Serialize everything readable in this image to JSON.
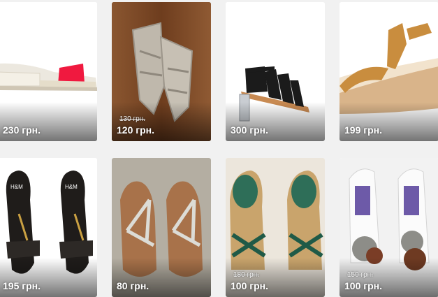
{
  "listings": [
    {
      "price": "230 грн.",
      "old_price": "",
      "product": "white-red-slide-sandal"
    },
    {
      "price": "120 грн.",
      "old_price": "130 грн.",
      "product": "grey-wedge-sandals"
    },
    {
      "price": "300 грн.",
      "old_price": "",
      "product": "black-strappy-block-heel"
    },
    {
      "price": "199 грн.",
      "old_price": "",
      "product": "tan-suede-wedge"
    },
    {
      "price": "195 грн.",
      "old_price": "",
      "product": "black-hm-flat-sandals"
    },
    {
      "price": "80 грн.",
      "old_price": "",
      "product": "silver-thong-sandals"
    },
    {
      "price": "100 грн.",
      "old_price": "180 грн.",
      "product": "green-platform-sandals"
    },
    {
      "price": "100 грн.",
      "old_price": "150 грн.",
      "product": "white-flower-platforms"
    }
  ],
  "colors": {
    "page_bg": "#f1f1f1",
    "price_text": "#ffffff"
  }
}
